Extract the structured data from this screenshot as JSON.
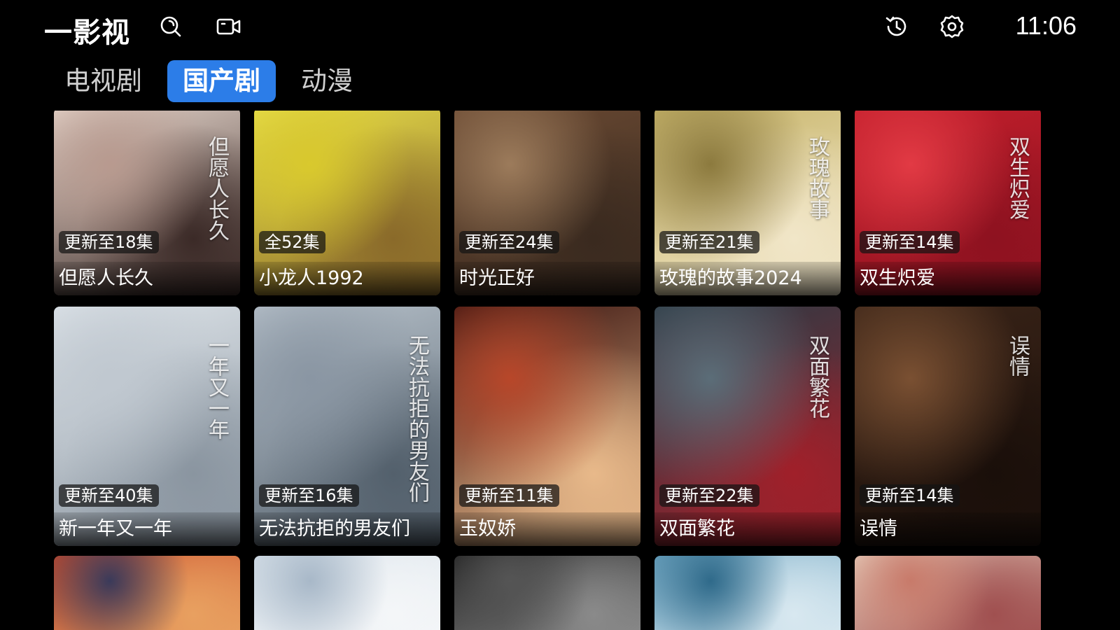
{
  "app": {
    "title": "一影视",
    "clock": "11:06"
  },
  "header": {
    "icons": [
      "search-icon",
      "video-camera-icon",
      "history-icon",
      "settings-icon"
    ]
  },
  "tabs": [
    {
      "label": "电视剧",
      "active": false
    },
    {
      "label": "国产剧",
      "active": true
    },
    {
      "label": "动漫",
      "active": false
    }
  ],
  "accent_color": "#2c7de8",
  "rows": [
    [
      {
        "badge": "更新至18集",
        "title": "但愿人长久",
        "poster_text": "但愿人长久",
        "colors": [
          "#e9d9cf",
          "#b89a8f",
          "#3b2a27"
        ]
      },
      {
        "badge": "全52集",
        "title": "小龙人1992",
        "poster_text": "",
        "colors": [
          "#e8df4a",
          "#d9c92d",
          "#8a6a2a"
        ]
      },
      {
        "badge": "更新至24集",
        "title": "时光正好",
        "poster_text": "",
        "colors": [
          "#6b4a33",
          "#9c7b5b",
          "#3a2a1f"
        ]
      },
      {
        "badge": "更新至21集",
        "title": "玫瑰的故事2024",
        "poster_text": "玫瑰故事",
        "colors": [
          "#c8b56a",
          "#8c7a3e",
          "#f1e6c8"
        ]
      },
      {
        "badge": "更新至14集",
        "title": "双生炽爱",
        "poster_text": "双生炽爱",
        "colors": [
          "#c41f2c",
          "#e23a44",
          "#8e1220"
        ]
      }
    ],
    [
      {
        "badge": "更新至40集",
        "title": "新一年又一年",
        "poster_text": "一年又一年",
        "colors": [
          "#dfe5ea",
          "#c0c8d0",
          "#8a95a0"
        ]
      },
      {
        "badge": "更新至16集",
        "title": "无法抗拒的男友们",
        "poster_text": "无法抗拒的男友们",
        "colors": [
          "#b9c3cc",
          "#8a96a3",
          "#53606c"
        ]
      },
      {
        "badge": "更新至11集",
        "title": "玉奴娇",
        "poster_text": "",
        "colors": [
          "#3a1410",
          "#b8472a",
          "#e8b98a"
        ]
      },
      {
        "badge": "更新至22集",
        "title": "双面繁花",
        "poster_text": "双面繁花",
        "colors": [
          "#2b3a44",
          "#5b6d78",
          "#a0202a"
        ]
      },
      {
        "badge": "更新至14集",
        "title": "误情",
        "poster_text": "误情",
        "colors": [
          "#3a2418",
          "#7a5032",
          "#1a0f0a"
        ]
      }
    ],
    [
      {
        "badge": "",
        "title": "",
        "poster_text": "",
        "colors": [
          "#c94a2a",
          "#3a3a5a",
          "#e8a060"
        ]
      },
      {
        "badge": "",
        "title": "",
        "poster_text": "",
        "colors": [
          "#d8e2ea",
          "#a8b8c8",
          "#f4f6f8"
        ]
      },
      {
        "badge": "",
        "title": "",
        "poster_text": "",
        "colors": [
          "#202020",
          "#555",
          "#8a8a8a"
        ]
      },
      {
        "badge": "",
        "title": "",
        "poster_text": "",
        "colors": [
          "#6fa6c2",
          "#2f6a8a",
          "#d8e8f0"
        ]
      },
      {
        "badge": "",
        "title": "",
        "poster_text": "",
        "colors": [
          "#e8d2c0",
          "#c87a6a",
          "#a05050"
        ]
      }
    ]
  ]
}
